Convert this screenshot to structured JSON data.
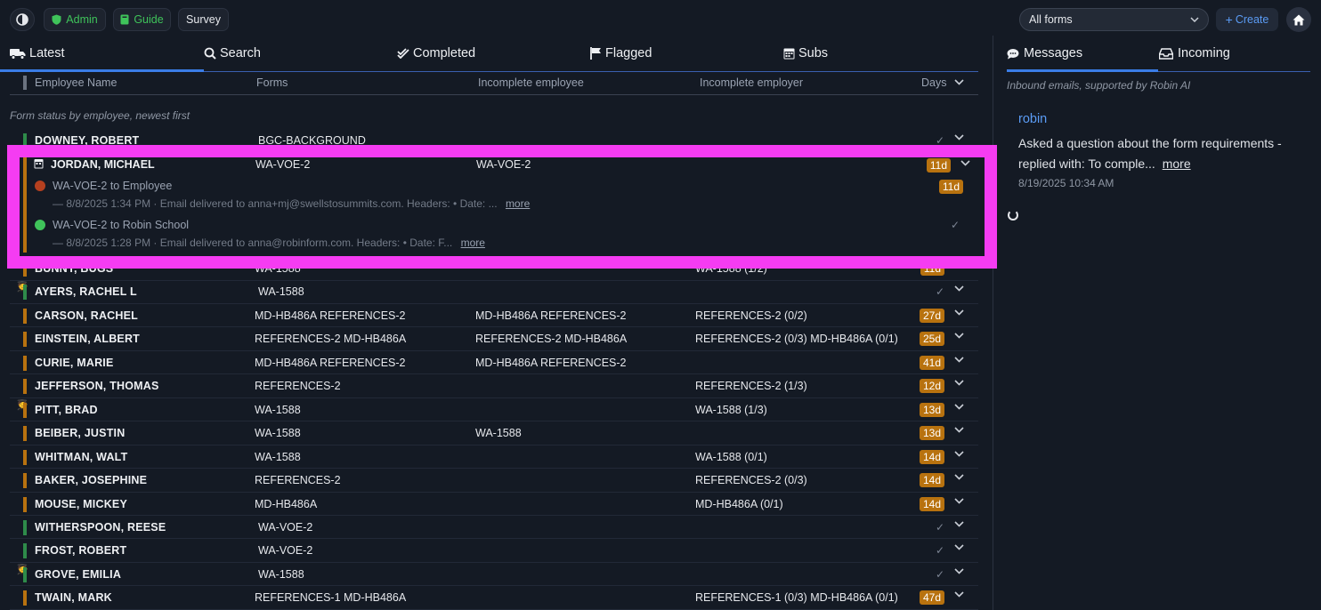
{
  "topbar": {
    "admin_label": "Admin",
    "guide_label": "Guide",
    "survey_label": "Survey",
    "forms_filter": "All forms",
    "create_label": "Create",
    "icons": [
      "contrast-icon",
      "shield-icon",
      "book-icon",
      "chevron-down-icon",
      "plus-icon",
      "home-icon"
    ]
  },
  "tabs": [
    {
      "label": "Latest",
      "icon": "truck-icon"
    },
    {
      "label": "Search",
      "icon": "search-icon"
    },
    {
      "label": "Completed",
      "icon": "double-check-icon"
    },
    {
      "label": "Flagged",
      "icon": "flag-icon"
    },
    {
      "label": "Subs",
      "icon": "calendar-icon"
    }
  ],
  "columns": [
    "Employee Name",
    "Forms",
    "Incomplete employee",
    "Incomplete employer",
    "Days"
  ],
  "hint": "Form status by employee, newest first",
  "colors": {
    "accent": "#3a7de6",
    "warn": "#b8720f",
    "ok": "#2e8b4a",
    "highlight": "#f53cf2",
    "link": "#5b9cf5"
  },
  "expanded": {
    "name": "JORDAN, MICHAEL",
    "forms": "WA-VOE-2",
    "incomplete_employee": "WA-VOE-2",
    "days": "11d",
    "subs": [
      {
        "title": "WA-VOE-2 to Employee",
        "days": "11d",
        "meta": "— 8/8/2025 1:34 PM · Email delivered to anna+mj@swellstosummits.com. Headers: • Date: ...",
        "more": "more"
      },
      {
        "title": "WA-VOE-2 to Robin School",
        "meta": "— 8/8/2025 1:28 PM · Email delivered to anna@robinform.com. Headers: • Date: F...",
        "more": "more"
      }
    ]
  },
  "rows": [
    {
      "name": "DOWNEY, ROBERT",
      "forms": "BGC-BACKGROUND",
      "emp": "",
      "employer": "",
      "days": "",
      "status": "ok"
    },
    {
      "name": "BUNNY, BUGS",
      "forms": "WA-1588",
      "emp": "",
      "employer": "WA-1588 (1/2)",
      "days": "11d",
      "status": "warn"
    },
    {
      "name": "AYERS, RACHEL L",
      "forms": "WA-1588",
      "emp": "",
      "employer": "",
      "days": "",
      "status": "ok",
      "emoji": true
    },
    {
      "name": "CARSON, RACHEL",
      "forms": "MD-HB486A REFERENCES-2",
      "emp": "MD-HB486A REFERENCES-2",
      "employer": "REFERENCES-2 (0/2)",
      "days": "27d",
      "status": "warn"
    },
    {
      "name": "EINSTEIN, ALBERT",
      "forms": "REFERENCES-2 MD-HB486A",
      "emp": "REFERENCES-2 MD-HB486A",
      "employer": "REFERENCES-2 (0/3) MD-HB486A (0/1)",
      "days": "25d",
      "status": "warn"
    },
    {
      "name": "CURIE, MARIE",
      "forms": "MD-HB486A REFERENCES-2",
      "emp": "MD-HB486A REFERENCES-2",
      "employer": "",
      "days": "41d",
      "status": "warn"
    },
    {
      "name": "JEFFERSON, THOMAS",
      "forms": "REFERENCES-2",
      "emp": "",
      "employer": "REFERENCES-2 (1/3)",
      "days": "12d",
      "status": "warn"
    },
    {
      "name": "PITT, BRAD",
      "forms": "WA-1588",
      "emp": "",
      "employer": "WA-1588 (1/3)",
      "days": "13d",
      "status": "warn",
      "emoji": true
    },
    {
      "name": "BEIBER, JUSTIN",
      "forms": "WA-1588",
      "emp": "WA-1588",
      "employer": "",
      "days": "13d",
      "status": "warn"
    },
    {
      "name": "WHITMAN, WALT",
      "forms": "WA-1588",
      "emp": "",
      "employer": "WA-1588 (0/1)",
      "days": "14d",
      "status": "warn"
    },
    {
      "name": "BAKER, JOSEPHINE",
      "forms": "REFERENCES-2",
      "emp": "",
      "employer": "REFERENCES-2 (0/3)",
      "days": "14d",
      "status": "warn"
    },
    {
      "name": "MOUSE, MICKEY",
      "forms": "MD-HB486A",
      "emp": "",
      "employer": "MD-HB486A (0/1)",
      "days": "14d",
      "status": "warn"
    },
    {
      "name": "WITHERSPOON, REESE",
      "forms": "WA-VOE-2",
      "emp": "",
      "employer": "",
      "days": "",
      "status": "ok"
    },
    {
      "name": "FROST, ROBERT",
      "forms": "WA-VOE-2",
      "emp": "",
      "employer": "",
      "days": "",
      "status": "ok"
    },
    {
      "name": "GROVE, EMILIA",
      "forms": "WA-1588",
      "emp": "",
      "employer": "",
      "days": "",
      "status": "ok",
      "emoji": true
    },
    {
      "name": "TWAIN, MARK",
      "forms": "REFERENCES-1 MD-HB486A",
      "emp": "",
      "employer": "REFERENCES-1 (0/3) MD-HB486A (0/1)",
      "days": "47d",
      "status": "warn"
    }
  ],
  "side": {
    "tabs": [
      {
        "label": "Messages",
        "icon": "chat-icon"
      },
      {
        "label": "Incoming",
        "icon": "inbox-icon"
      }
    ],
    "hint": "Inbound emails, supported by Robin AI",
    "message": {
      "sender": "robin",
      "body": "Asked a question about the form requirements - replied with: To comple...",
      "more": "more",
      "date": "8/19/2025 10:34 AM"
    }
  }
}
